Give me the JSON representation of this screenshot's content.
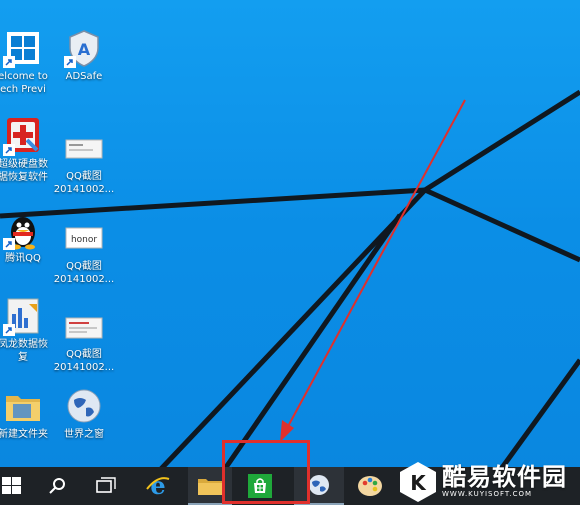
{
  "desktop": {
    "icons": [
      {
        "label": "elcome to\nech Previ",
        "icon": "welcome-tile-icon"
      },
      {
        "label": "ADSafe",
        "icon": "adsafe-shield-icon"
      },
      {
        "label": "超级硬盘数\n据恢复软件",
        "icon": "disk-recovery-icon"
      },
      {
        "label": "QQ截图\n20141002...",
        "icon": "screenshot-thumbnail-icon"
      },
      {
        "label": "腾讯QQ",
        "icon": "qq-penguin-icon"
      },
      {
        "label": "QQ截图\n20141002...",
        "icon": "honor-screenshot-icon"
      },
      {
        "label": "凤龙数据恢\n复",
        "icon": "data-recovery-icon"
      },
      {
        "label": "QQ截图\n20141002...",
        "icon": "screenshot-thumbnail-icon"
      },
      {
        "label": "新建文件夹",
        "icon": "folder-icon"
      },
      {
        "label": "世界之窗",
        "icon": "globe-browser-icon"
      }
    ],
    "honor_text": "honor"
  },
  "taskbar": {
    "items": [
      "start-icon",
      "search-icon",
      "task-view-icon",
      "internet-explorer-icon",
      "file-explorer-icon",
      "store-icon",
      "globe-browser-icon",
      "paint-palette-icon"
    ]
  },
  "watermark": {
    "title": "酷易软件园",
    "url": "WWW.KUYISOFT.COM",
    "logo_letter": "K"
  },
  "colors": {
    "wallpaper": "#0b8ee6",
    "taskbar": "#1e2226",
    "annotation": "#e0302c",
    "store_green": "#1fa83a"
  }
}
